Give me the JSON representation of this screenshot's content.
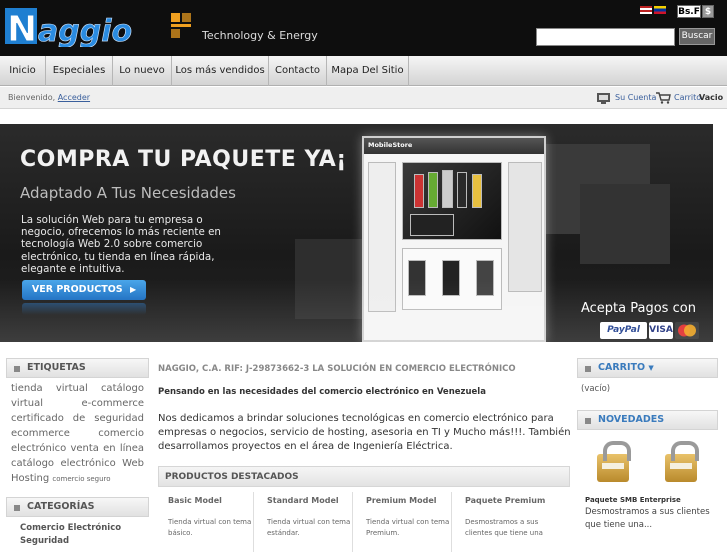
{
  "header": {
    "logo_text": "Naggio",
    "tagline": "Technology & Energy",
    "currencies": [
      "Bs.F",
      "$"
    ],
    "search_button": "Buscar",
    "search_value": ""
  },
  "nav": {
    "items": [
      "Inicio",
      "Especiales",
      "Lo nuevo",
      "Los más vendidos",
      "Contacto",
      "Mapa Del Sitio"
    ]
  },
  "subbar": {
    "welcome": "Bienvenido,",
    "login_link": "Acceder",
    "account_link": "Su Cuenta",
    "cart_link": "Carrito",
    "cart_status": "Vacio"
  },
  "banner": {
    "title": "COMPRA TU PAQUETE YA¡",
    "subtitle": "Adaptado A Tus Necesidades",
    "description": "La solución Web para tu empresa o negocio, ofrecemos lo más reciente en tecnología Web 2.0 sobre comercio electrónico, tu tienda en línea rápida, elegante e intuitiva.",
    "button_label": "VER PRODUCTOS",
    "button_arrow": "▶",
    "mock_store": "MobileStore",
    "payments_title": "Acepta Pagos con",
    "cards": [
      "PayPal",
      "VISA",
      "MC"
    ]
  },
  "left": {
    "tags_title": "ETIQUETAS",
    "tags": [
      "tienda",
      "virtual",
      "catálogo",
      "virtual",
      "e-commerce",
      "certificado",
      "de",
      "seguridad",
      "ecommerce",
      "comercio",
      "electrónico",
      "venta",
      "en",
      "línea",
      "catálogo",
      "electrónico",
      "Web",
      "Hosting"
    ],
    "tag_small": "comercio seguro",
    "categories_title": "CATEGORÍAS",
    "categories": [
      "Comercio Electrónico",
      "Seguridad"
    ]
  },
  "center": {
    "title": "NAGGIO, C.A. RIF: J-29873662-3 LA SOLUCIÓN EN COMERCIO ELECTRÓNICO",
    "subtitle": "Pensando en las necesidades del comercio electrónico en Venezuela",
    "body": "Nos dedicamos a brindar soluciones tecnológicas en comercio electrónico para empresas o negocios, servicio de hosting, asesoria en TI y Mucho más!!!. También desarrollamos proyectos en el área de Ingeniería Eléctrica.",
    "featured_title": "PRODUCTOS DESTACADOS",
    "products": [
      {
        "name": "Basic Model",
        "desc": "Tienda virtual con tema básico."
      },
      {
        "name": "Standard Model",
        "desc": "Tienda virtual con tema estándar."
      },
      {
        "name": "Premium Model",
        "desc": "Tienda virtual con tema Premium."
      },
      {
        "name": "Paquete Premium",
        "desc": "Desmostramos a sus clientes que tiene una"
      }
    ]
  },
  "right": {
    "cart_title": "CARRITO",
    "cart_empty": "(vacío)",
    "news_title": "NOVEDADES",
    "news_item_name": "Paquete SMB Enterprise",
    "news_item_desc": "Desmostramos a sus clientes que tiene una..."
  }
}
